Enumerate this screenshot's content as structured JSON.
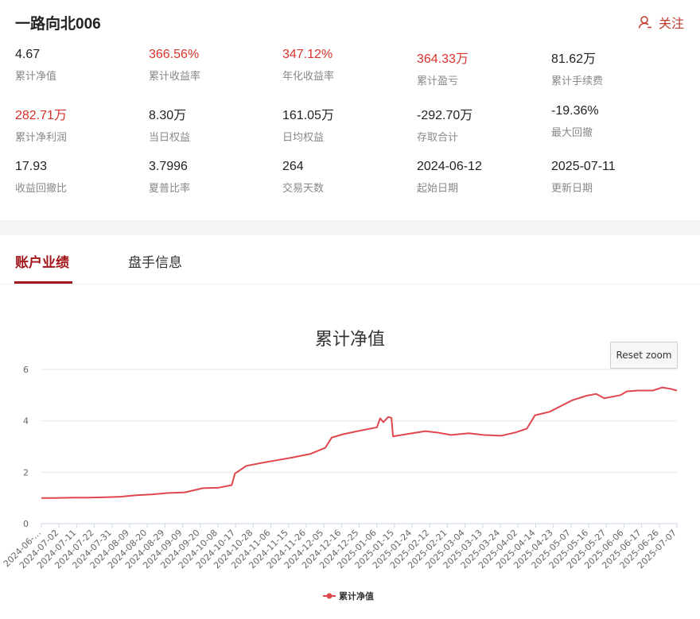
{
  "header": {
    "title": "一路向北006",
    "follow_label": "关注"
  },
  "stats": [
    {
      "value": "4.67",
      "label": "累计净值",
      "red": false
    },
    {
      "value": "366.56%",
      "label": "累计收益率",
      "red": true
    },
    {
      "value": "347.12%",
      "label": "年化收益率",
      "red": true
    },
    {
      "value": "364.33万",
      "label": "累计盈亏",
      "red": true
    },
    {
      "value": "81.62万",
      "label": "累计手续费",
      "red": false
    },
    {
      "value": "282.71万",
      "label": "累计净利润",
      "red": true
    },
    {
      "value": "8.30万",
      "label": "当日权益",
      "red": false
    },
    {
      "value": "161.05万",
      "label": "日均权益",
      "red": false
    },
    {
      "value": "-292.70万",
      "label": "存取合计",
      "red": false
    },
    {
      "value": "-19.36%",
      "label": "最大回撤",
      "red": false
    },
    {
      "value": "17.93",
      "label": "收益回撤比",
      "red": false
    },
    {
      "value": "3.7996",
      "label": "夏普比率",
      "red": false
    },
    {
      "value": "264",
      "label": "交易天数",
      "red": false
    },
    {
      "value": "2024-06-12",
      "label": "起始日期",
      "red": false
    },
    {
      "value": "2025-07-11",
      "label": "更新日期",
      "red": false
    }
  ],
  "tabs": [
    {
      "label": "账户业绩",
      "active": true
    },
    {
      "label": "盘手信息",
      "active": false
    }
  ],
  "reset_zoom_label": "Reset zoom",
  "colors": {
    "accent": "#a3161b",
    "positive": "#d9312b",
    "line": "#e0474c"
  },
  "chart_data": {
    "type": "line",
    "title": "累计净值",
    "xlabel": "",
    "ylabel": "",
    "ylim": [
      0,
      6
    ],
    "yticks": [
      0,
      2,
      4,
      6
    ],
    "grid": true,
    "legend": "bottom-center",
    "x_tick_labels": [
      "2024-06-…",
      "2024-07-02",
      "2024-07-11",
      "2024-07-22",
      "2024-07-31",
      "2024-08-09",
      "2024-08-20",
      "2024-08-29",
      "2024-09-09",
      "2024-09-20",
      "2024-10-08",
      "2024-10-17",
      "2024-10-28",
      "2024-11-06",
      "2024-11-15",
      "2024-11-26",
      "2024-12-05",
      "2024-12-16",
      "2024-12-25",
      "2025-01-06",
      "2025-01-15",
      "2025-01-24",
      "2025-02-12",
      "2025-02-21",
      "2025-03-04",
      "2025-03-13",
      "2025-03-24",
      "2025-04-02",
      "2025-04-14",
      "2025-04-23",
      "2025-05-07",
      "2025-05-16",
      "2025-05-27",
      "2025-06-06",
      "2025-06-17",
      "2025-06-26",
      "2025-07-07"
    ],
    "series": [
      {
        "name": "累计净值",
        "color": "#e0474c",
        "points": [
          [
            "2024-06-12",
            1.0
          ],
          [
            "2024-06-20",
            1.0
          ],
          [
            "2024-07-02",
            1.01
          ],
          [
            "2024-07-11",
            1.01
          ],
          [
            "2024-07-22",
            1.03
          ],
          [
            "2024-07-31",
            1.05
          ],
          [
            "2024-08-09",
            1.1
          ],
          [
            "2024-08-20",
            1.14
          ],
          [
            "2024-08-29",
            1.19
          ],
          [
            "2024-09-09",
            1.22
          ],
          [
            "2024-09-20",
            1.38
          ],
          [
            "2024-09-30",
            1.4
          ],
          [
            "2024-10-08",
            1.5
          ],
          [
            "2024-10-10",
            1.95
          ],
          [
            "2024-10-17",
            2.25
          ],
          [
            "2024-10-28",
            2.38
          ],
          [
            "2024-11-06",
            2.48
          ],
          [
            "2024-11-15",
            2.58
          ],
          [
            "2024-11-26",
            2.72
          ],
          [
            "2024-12-05",
            2.95
          ],
          [
            "2024-12-09",
            3.35
          ],
          [
            "2024-12-16",
            3.48
          ],
          [
            "2024-12-25",
            3.6
          ],
          [
            "2025-01-06",
            3.75
          ],
          [
            "2025-01-08",
            4.1
          ],
          [
            "2025-01-10",
            3.95
          ],
          [
            "2025-01-13",
            4.15
          ],
          [
            "2025-01-15",
            4.12
          ],
          [
            "2025-01-16",
            3.4
          ],
          [
            "2025-01-24",
            3.48
          ],
          [
            "2025-02-05",
            3.6
          ],
          [
            "2025-02-12",
            3.55
          ],
          [
            "2025-02-21",
            3.45
          ],
          [
            "2025-03-04",
            3.52
          ],
          [
            "2025-03-13",
            3.45
          ],
          [
            "2025-03-24",
            3.42
          ],
          [
            "2025-04-02",
            3.55
          ],
          [
            "2025-04-09",
            3.7
          ],
          [
            "2025-04-14",
            4.22
          ],
          [
            "2025-04-23",
            4.35
          ],
          [
            "2025-05-07",
            4.8
          ],
          [
            "2025-05-16",
            4.98
          ],
          [
            "2025-05-22",
            5.05
          ],
          [
            "2025-05-27",
            4.88
          ],
          [
            "2025-06-06",
            5.0
          ],
          [
            "2025-06-10",
            5.15
          ],
          [
            "2025-06-17",
            5.18
          ],
          [
            "2025-06-26",
            5.18
          ],
          [
            "2025-07-02",
            5.3
          ],
          [
            "2025-07-07",
            5.25
          ],
          [
            "2025-07-11",
            5.18
          ]
        ]
      }
    ]
  }
}
